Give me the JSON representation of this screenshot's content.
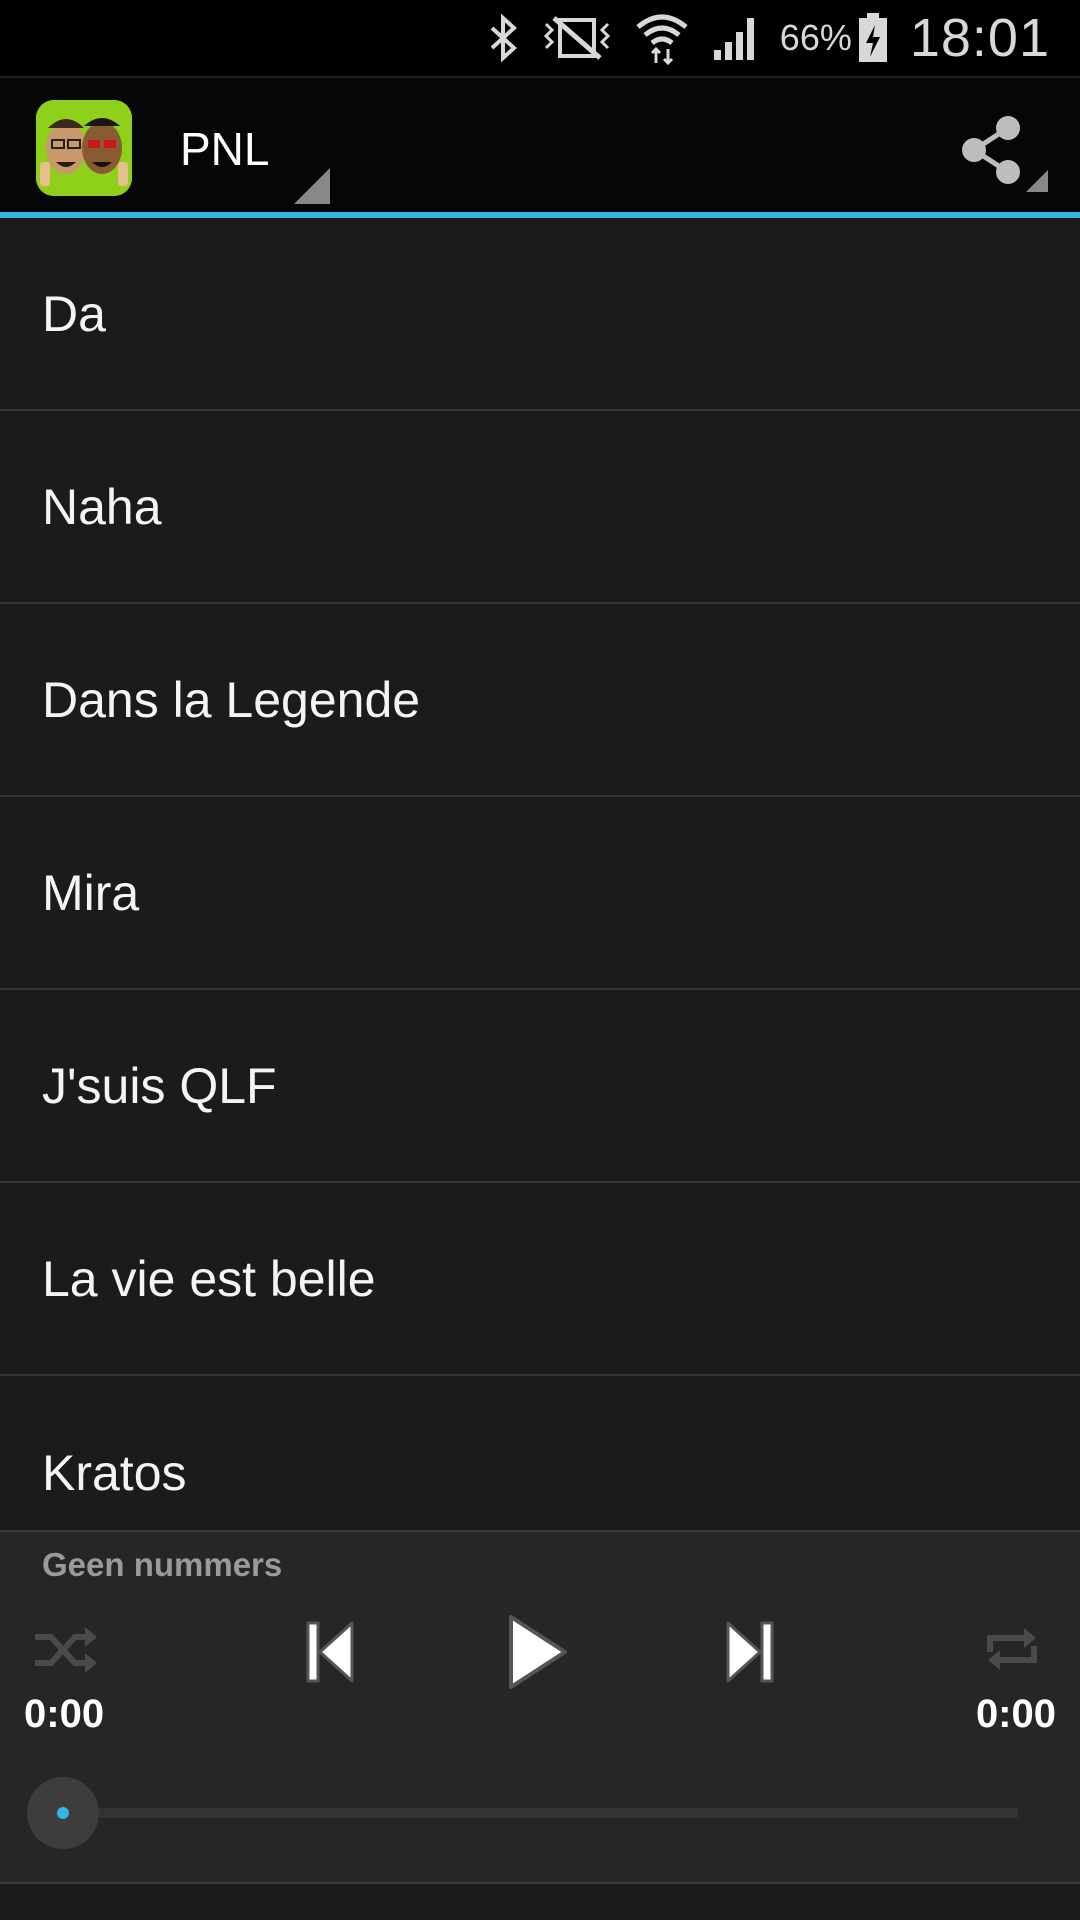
{
  "status_bar": {
    "battery_percent": "66%",
    "time": "18:01",
    "icons": [
      "bluetooth-icon",
      "vibrate-mute-icon",
      "wifi-icon",
      "signal-icon",
      "battery-charging-icon"
    ]
  },
  "action_bar": {
    "title": "PNL",
    "accent_color": "#33b5e5",
    "logo_icon": "app-logo-icon",
    "share_icon": "share-icon"
  },
  "songs": [
    {
      "title": "Da"
    },
    {
      "title": "Naha"
    },
    {
      "title": "Dans la Legende"
    },
    {
      "title": "Mira"
    },
    {
      "title": "J'suis QLF"
    },
    {
      "title": "La vie est belle"
    },
    {
      "title": "Kratos"
    }
  ],
  "player": {
    "status_text": "Geen nummers",
    "current_time": "0:00",
    "total_time": "0:00",
    "progress": 0,
    "icons": [
      "shuffle-icon",
      "previous-icon",
      "play-icon",
      "next-icon",
      "repeat-icon"
    ]
  }
}
